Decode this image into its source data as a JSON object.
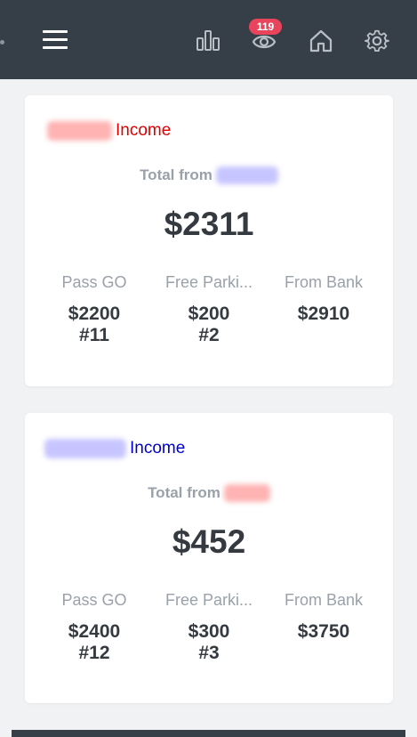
{
  "navbar": {
    "notification_count": "119",
    "icons": [
      "menu-icon",
      "bar-chart-icon",
      "eye-icon",
      "home-icon",
      "gear-icon"
    ]
  },
  "cards": [
    {
      "title": "Income",
      "title_color": "#e00000",
      "total_prefix": "Total from",
      "total": "$2311",
      "stats": [
        {
          "label": "Pass GO",
          "value": "$2200",
          "count": "#11"
        },
        {
          "label": "Free Parki...",
          "value": "$200",
          "count": "#2"
        },
        {
          "label": "From Bank",
          "value": "$2910"
        }
      ]
    },
    {
      "title": "Income",
      "title_color": "#0000cc",
      "total_prefix": "Total from",
      "total": "$452",
      "stats": [
        {
          "label": "Pass GO",
          "value": "$2400",
          "count": "#12"
        },
        {
          "label": "Free Parki...",
          "value": "$300",
          "count": "#3"
        },
        {
          "label": "From Bank",
          "value": "$3750"
        }
      ]
    }
  ]
}
